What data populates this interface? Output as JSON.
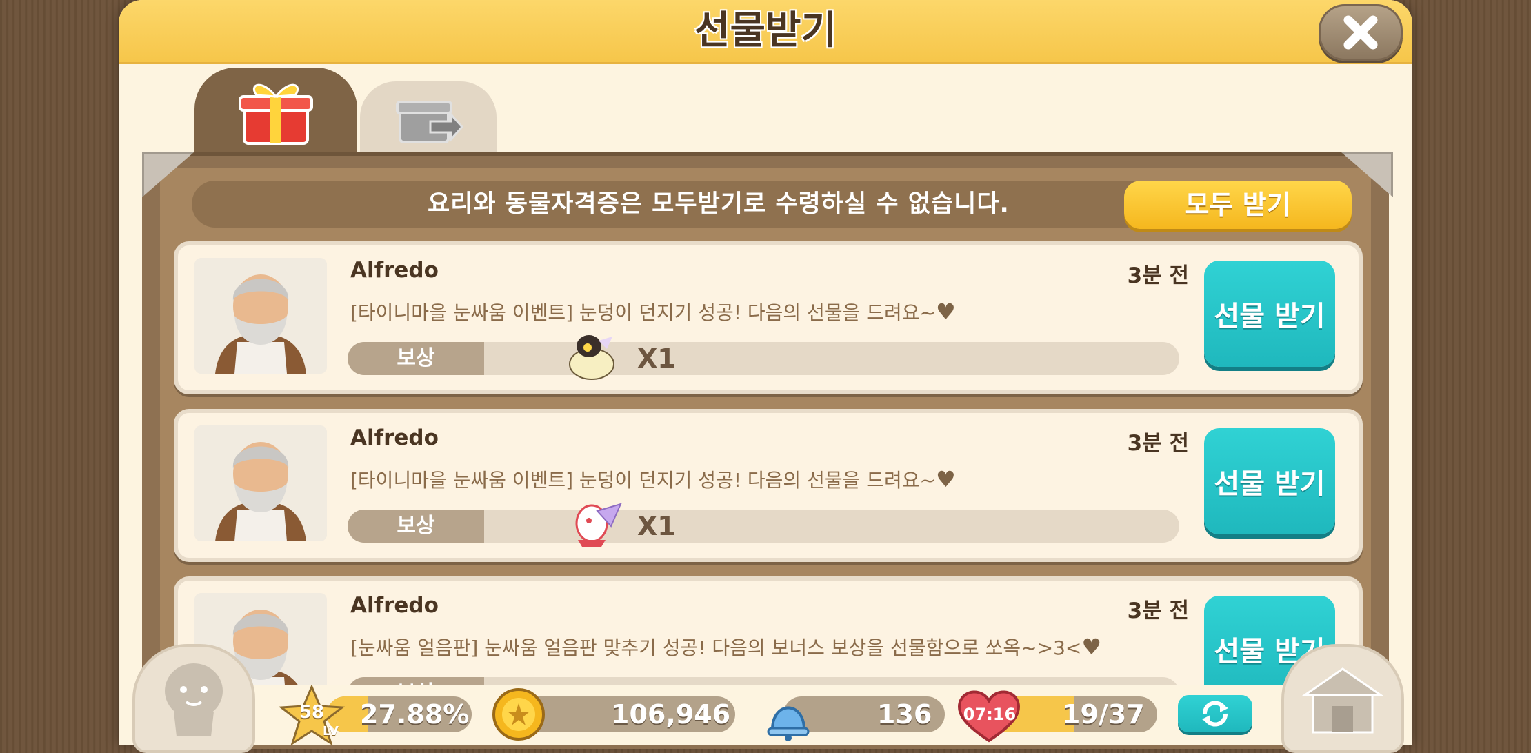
{
  "header": {
    "title": "선물받기"
  },
  "notice": {
    "text": "요리와 동물자격증은 모두받기로 수령하실 수 없습니다.",
    "receive_all_label": "모두 받기"
  },
  "gifts": [
    {
      "sender": "Alfredo",
      "time": "3분 전",
      "message": "[타이니마을 눈싸움 이벤트] 눈덩이 던지기 성공! 다음의 선물을 드려요~",
      "reward_label": "보상",
      "reward_qty": "X1",
      "reward_icon": "penguin-costume-icon",
      "button_label": "선물 받기"
    },
    {
      "sender": "Alfredo",
      "time": "3분 전",
      "message": "[타이니마을 눈싸움 이벤트] 눈덩이 던지기 성공! 다음의 선물을 드려요~",
      "reward_label": "보상",
      "reward_qty": "X1",
      "reward_icon": "dragon-costume-icon",
      "button_label": "선물 받기"
    },
    {
      "sender": "Alfredo",
      "time": "3분 전",
      "message": "[눈싸움 얼음판] 눈싸움 얼음판 맞추기 성공! 다음의 보너스 보상을 선물함으로 쏘옥~>3<",
      "reward_label": "보상",
      "reward_qty": "",
      "reward_icon": "heart-icon",
      "button_label": "선물 받기"
    }
  ],
  "status": {
    "level": "58",
    "level_unit": "LV",
    "exp_percent": "27.88%",
    "exp_fraction": 0.2788,
    "coins": "106,946",
    "bells": "136",
    "heart_timer": "07:16",
    "hearts": "19/37",
    "hearts_fraction": 0.5135
  },
  "colors": {
    "header": "#f6c64a",
    "accent_teal": "#1fb8bd",
    "button_yellow": "#f5b71e",
    "frame_brown": "#8e7152"
  }
}
